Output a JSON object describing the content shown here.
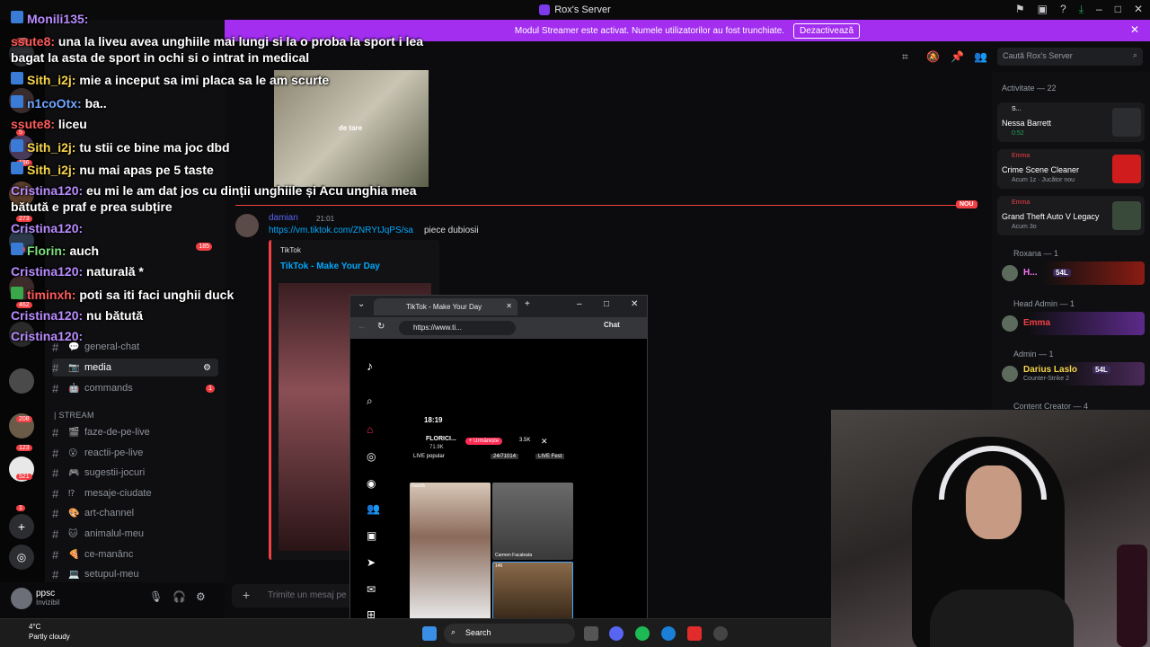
{
  "window": {
    "title": "Rox's Server"
  },
  "banner": {
    "text": "Modul Streamer este activat. Numele utilizatorilor au fost trunchiate.",
    "button": "Dezactivează"
  },
  "search": {
    "placeholder": "Caută Rox's Server"
  },
  "rail_badges": [
    "32",
    "5",
    "186",
    "273",
    "6",
    "462",
    "208",
    "123",
    "521",
    "1"
  ],
  "categories": {
    "stream": "| STREAM"
  },
  "channels": [
    {
      "emoji": "💬",
      "name": "general-chat",
      "active": false
    },
    {
      "emoji": "📷",
      "name": "media",
      "active": true
    },
    {
      "emoji": "🤖",
      "name": "commands",
      "badge": "1"
    },
    {
      "emoji": "🎬",
      "name": "faze-de-pe-live"
    },
    {
      "emoji": "😮",
      "name": "reactii-pe-live"
    },
    {
      "emoji": "🎮",
      "name": "sugestii-jocuri"
    },
    {
      "emoji": "⁉",
      "name": "mesaje-ciudate"
    },
    {
      "emoji": "🎨",
      "name": "art-channel"
    },
    {
      "emoji": "🐱",
      "name": "animalul-meu"
    },
    {
      "emoji": "🍕",
      "name": "ce-manânc"
    },
    {
      "emoji": "💻",
      "name": "setupul-meu"
    }
  ],
  "channel_badge_185": "185",
  "user": {
    "name": "ppsc",
    "status": "Invizibil"
  },
  "chat": {
    "image_caption": "de tare",
    "new_label": "NOU",
    "author": "damian",
    "time": "21:01",
    "link": "https://vm.tiktok.com/ZNRYtJqPS/sa",
    "text": "piece dubiosii",
    "embed_provider": "TikTok",
    "embed_title": "TikTok - Make Your Day",
    "composer_placeholder": "Trimite un mesaj pe"
  },
  "members": {
    "activity_header": "Activitate — 22",
    "activities": [
      {
        "who": "S...",
        "title": "Nessa Barrett",
        "sub": "0:52"
      },
      {
        "who": "Emma",
        "title": "Crime Scene Cleaner",
        "sub": "Acum 1z · Jucător nou"
      },
      {
        "who": "Emma",
        "title": "Grand Theft Auto V Legacy",
        "sub": "Acum 3o"
      }
    ],
    "groups": [
      {
        "header": "Roxana — 1",
        "name": "H...",
        "tag": "54L"
      },
      {
        "header": "Head Admin — 1",
        "name": "Emma"
      },
      {
        "header": "Admin — 1",
        "name": "Darius Laslo",
        "tag": "54L",
        "sub": "Counter-Strike 2"
      },
      {
        "header": "Content Creator — 4"
      }
    ]
  },
  "tiktok": {
    "tab_title": "TikTok - Make Your Day",
    "url": "https://www.ti...",
    "chat_label": "Chat",
    "phone_time": "18:19",
    "creator": "FLORICI...",
    "followers": "71.9K",
    "follow_btn": "+ Urmărește",
    "viewers": "3.5K",
    "live_popular": "LIVE popular",
    "rank": "24/71014",
    "live_fest": "LIVE Fest",
    "tile1_label": "Gazdă",
    "tile2_label": "Carmen Facaleata",
    "tile3_label": "146"
  },
  "overlay": [
    {
      "user": "Monili135:",
      "text": ""
    },
    {
      "user": "ssute8:",
      "text": "una la liveu avea unghiile mai lungi si la o proba la sport i lea"
    },
    {
      "user": "",
      "text": "bagat la asta de sport in ochi si o intrat in medical"
    },
    {
      "user": "Sith_i2j:",
      "text": "mie a inceput sa imi placa sa le am scurte"
    },
    {
      "user": "n1coOtx:",
      "text": "ba.."
    },
    {
      "user": "ssute8:",
      "text": "liceu"
    },
    {
      "user": "Sith_i2j:",
      "text": "tu stii ce bine ma joc dbd"
    },
    {
      "user": "Sith_i2j:",
      "text": "nu mai apas pe 5 taste"
    },
    {
      "user": "Cristina120:",
      "text": "eu mi le am dat jos cu dinții unghiile și Acu unghia mea"
    },
    {
      "user": "",
      "text": "bătută e praf e prea subțire"
    },
    {
      "user": "Cristina120:",
      "text": ""
    },
    {
      "user": "Florin:",
      "text": "auch"
    },
    {
      "user": "Cristina120:",
      "text": "naturală *"
    },
    {
      "user": "timinxh:",
      "text": "poti sa iti faci unghii duck"
    },
    {
      "user": "Cristina120:",
      "text": "nu bătută"
    },
    {
      "user": "Cristina120:",
      "text": ""
    }
  ],
  "taskbar": {
    "temp": "4°C",
    "weather": "Partly cloudy",
    "search": "Search"
  },
  "colors": {
    "accent": "#a32ef0",
    "alert": "#f23f43",
    "link": "#00a8fc"
  }
}
